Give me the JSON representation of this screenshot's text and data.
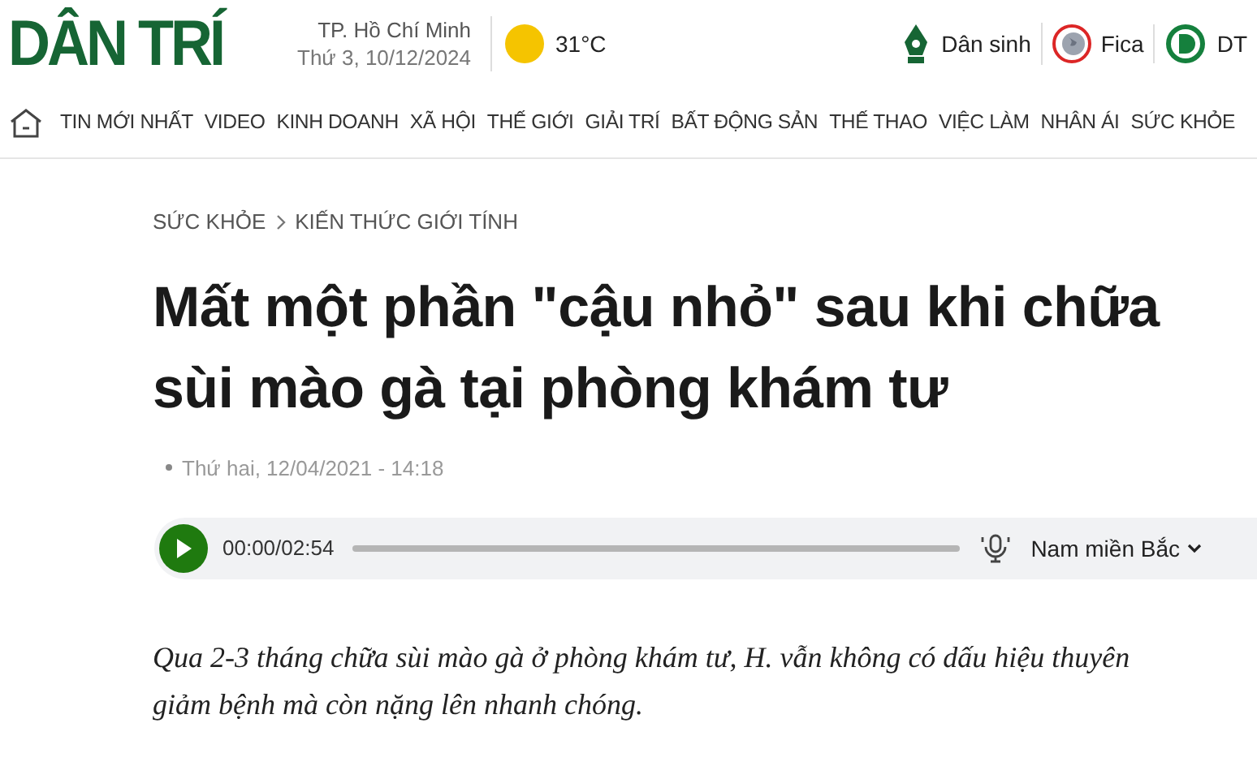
{
  "header": {
    "logo": "DÂN TRÍ",
    "city": "TP. Hồ Chí Minh",
    "date": "Thứ 3, 10/12/2024",
    "temperature": "31°C",
    "links": [
      {
        "label": "Dân sinh",
        "kind": "pen"
      },
      {
        "label": "Fica",
        "kind": "globe"
      },
      {
        "label": "DT",
        "kind": "d"
      }
    ]
  },
  "nav": [
    "TIN MỚI NHẤT",
    "VIDEO",
    "KINH DOANH",
    "XÃ HỘI",
    "THẾ GIỚI",
    "GIẢI TRÍ",
    "BẤT ĐỘNG SẢN",
    "THẾ THAO",
    "VIỆC LÀM",
    "NHÂN ÁI",
    "SỨC KHỎE"
  ],
  "breadcrumb": [
    "SỨC KHỎE",
    "KIẾN THỨC GIỚI TÍNH"
  ],
  "article": {
    "title": "Mất một phần \"cậu nhỏ\" sau khi chữa sùi mào gà tại phòng khám tư",
    "published": "Thứ hai, 12/04/2021 - 14:18",
    "audio": {
      "time": "00:00/02:54",
      "level": 0,
      "voice": "Nam miền Bắc"
    },
    "lede": "Qua 2-3 tháng chữa sùi mào gà ở phòng khám tư, H. vẫn không có dấu hiệu thuyên giảm bệnh mà còn nặng lên nhanh chóng."
  }
}
